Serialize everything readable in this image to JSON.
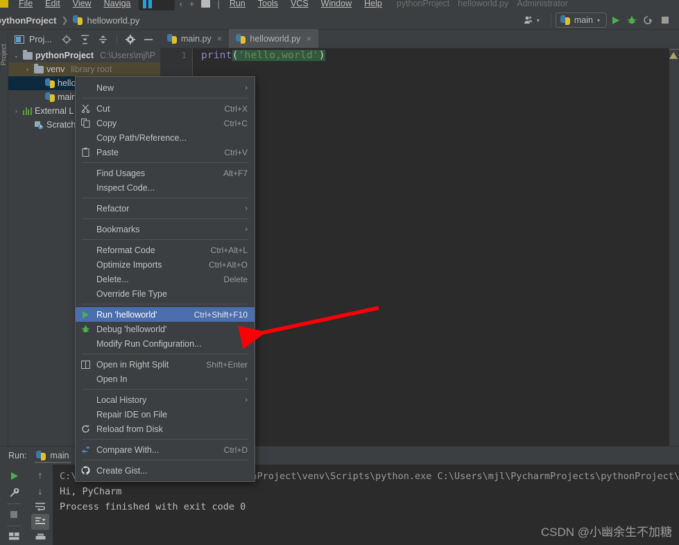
{
  "menubar": {
    "items": [
      "File",
      "Edit",
      "View",
      "Naviga"
    ],
    "items_right": [
      "Run",
      "Tools",
      "VCS",
      "Window",
      "Help"
    ],
    "window_title": "pythonProject - helloworld.py - Administrator",
    "title_project": "pythonProject",
    "title_file": "helloworld.py",
    "title_user": "Administrator"
  },
  "breadcrumb": {
    "project": "pythonProject",
    "separator": "❯",
    "file": "helloworld.py",
    "file_icon": "python-file-icon"
  },
  "topbar": {
    "user_icon": "user-settings-icon",
    "run_config": "main",
    "run_config_icon": "python-file-icon",
    "dropdown_caret": "▾",
    "run_icon": "run-icon",
    "debug_icon": "debug-icon",
    "coverage_icon": "run-with-coverage-icon",
    "stop_icon": "stop-icon"
  },
  "toolwindow": {
    "left_strip_label": "Project",
    "title": "Proj...",
    "title_icon": "project-window-icon",
    "icons": [
      "locate-icon",
      "expand-all-icon",
      "collapse-all-icon",
      "settings-gear-icon",
      "hide-icon"
    ]
  },
  "tree": {
    "items": [
      {
        "name": "pythonProject",
        "meta": "C:\\Users\\mjl\\P",
        "depth": 0,
        "arrow": "⌄",
        "icon": "folder-icon",
        "bold": true,
        "state": "none"
      },
      {
        "name": "venv",
        "meta": "library root",
        "depth": 1,
        "arrow": "›",
        "icon": "folder-icon",
        "bold": false,
        "state": "olive"
      },
      {
        "name": "hellow",
        "meta": "",
        "depth": 2,
        "arrow": "",
        "icon": "python-file-icon",
        "bold": false,
        "state": "blue"
      },
      {
        "name": "main.p",
        "meta": "",
        "depth": 2,
        "arrow": "",
        "icon": "python-file-icon",
        "bold": false,
        "state": "none"
      },
      {
        "name": "External L",
        "meta": "",
        "depth": 0,
        "arrow": "›",
        "icon": "library-icon",
        "bold": false,
        "state": "none"
      },
      {
        "name": "Scratches",
        "meta": "",
        "depth": 1,
        "arrow": "",
        "icon": "scratches-icon",
        "bold": false,
        "state": "none"
      }
    ]
  },
  "tabs": [
    {
      "label": "main.py",
      "icon": "python-file-icon",
      "active": false,
      "close": "×"
    },
    {
      "label": "helloworld.py",
      "icon": "python-file-icon",
      "active": true,
      "close": "×"
    }
  ],
  "editor": {
    "line_number": "1",
    "code_fn": "print",
    "code_open": "(",
    "code_string": "'hello,world'",
    "code_close": ")",
    "warning_icon": "warning-triangle-icon"
  },
  "contextmenu": {
    "groups": [
      [
        {
          "label": "New",
          "underline": "N",
          "key": "",
          "icon": "",
          "submenu": "›",
          "highlight": false
        }
      ],
      [
        {
          "label": "Cut",
          "underline": "C",
          "key": "Ctrl+X",
          "icon": "scissors-icon",
          "submenu": "",
          "highlight": false
        },
        {
          "label": "Copy",
          "underline": "C",
          "key": "Ctrl+C",
          "icon": "copy-icon",
          "submenu": "",
          "highlight": false
        },
        {
          "label": "Copy Path/Reference...",
          "underline": "",
          "key": "",
          "icon": "",
          "submenu": "",
          "highlight": false
        },
        {
          "label": "Paste",
          "underline": "P",
          "key": "Ctrl+V",
          "icon": "paste-icon",
          "submenu": "",
          "highlight": false
        }
      ],
      [
        {
          "label": "Find Usages",
          "underline": "U",
          "key": "Alt+F7",
          "icon": "",
          "submenu": "",
          "highlight": false
        },
        {
          "label": "Inspect Code...",
          "underline": "I",
          "key": "",
          "icon": "",
          "submenu": "",
          "highlight": false
        }
      ],
      [
        {
          "label": "Refactor",
          "underline": "R",
          "key": "",
          "icon": "",
          "submenu": "›",
          "highlight": false
        }
      ],
      [
        {
          "label": "Bookmarks",
          "underline": "",
          "key": "",
          "icon": "",
          "submenu": "›",
          "highlight": false
        }
      ],
      [
        {
          "label": "Reformat Code",
          "underline": "R",
          "key": "Ctrl+Alt+L",
          "icon": "",
          "submenu": "",
          "highlight": false
        },
        {
          "label": "Optimize Imports",
          "underline": "z",
          "key": "Ctrl+Alt+O",
          "icon": "",
          "submenu": "",
          "highlight": false
        },
        {
          "label": "Delete...",
          "underline": "D",
          "key": "Delete",
          "icon": "",
          "submenu": "",
          "highlight": false
        },
        {
          "label": "Override File Type",
          "underline": "",
          "key": "",
          "icon": "",
          "submenu": "",
          "highlight": false
        }
      ],
      [
        {
          "label": "Run 'helloworld'",
          "underline": "u",
          "key": "Ctrl+Shift+F10",
          "icon": "run-icon",
          "submenu": "",
          "highlight": true
        },
        {
          "label": "Debug 'helloworld'",
          "underline": "D",
          "key": "",
          "icon": "debug-icon",
          "submenu": "",
          "highlight": false
        },
        {
          "label": "Modify Run Configuration...",
          "underline": "",
          "key": "",
          "icon": "",
          "submenu": "",
          "highlight": false
        }
      ],
      [
        {
          "label": "Open in Right Split",
          "underline": "",
          "key": "Shift+Enter",
          "icon": "split-icon",
          "submenu": "",
          "highlight": false
        },
        {
          "label": "Open In",
          "underline": "",
          "key": "",
          "icon": "",
          "submenu": "›",
          "highlight": false
        }
      ],
      [
        {
          "label": "Local History",
          "underline": "H",
          "key": "",
          "icon": "",
          "submenu": "›",
          "highlight": false
        },
        {
          "label": "Repair IDE on File",
          "underline": "",
          "key": "",
          "icon": "",
          "submenu": "",
          "highlight": false
        },
        {
          "label": "Reload from Disk",
          "underline": "",
          "key": "",
          "icon": "reload-icon",
          "submenu": "",
          "highlight": false
        }
      ],
      [
        {
          "label": "Compare With...",
          "underline": "",
          "key": "Ctrl+D",
          "icon": "compare-icon",
          "submenu": "",
          "highlight": false
        }
      ],
      [
        {
          "label": "Create Gist...",
          "underline": "",
          "key": "",
          "icon": "github-icon",
          "submenu": "",
          "highlight": false
        }
      ]
    ]
  },
  "runpanel": {
    "label": "Run:",
    "tab_label": "main",
    "tab_icon": "python-file-icon",
    "side_icons": [
      "rerun-icon",
      "wrench-icon",
      "stop-icon",
      "layout-icon"
    ],
    "side_icons2": [
      "up-arrow-icon",
      "down-arrow-icon",
      "soft-wrap-icon",
      "scroll-to-end-icon",
      "print-icon"
    ],
    "console": [
      "C:\\Users\\mjl\\PycharmProjects\\pythonProject\\venv\\Scripts\\python.exe C:\\Users\\mjl\\PycharmProjects\\pythonProject\\mai",
      "Hi, PyCharm",
      "",
      "Process finished with exit code 0"
    ]
  },
  "watermark": "CSDN @小幽余生不加糖",
  "colors": {
    "accent_blue": "#4b6eaf",
    "annotation_red": "#fb0007",
    "selection_blue": "#0d293e",
    "selection_olive": "#4e4731",
    "editor_bg": "#2b2b2b",
    "panel_bg": "#3c3f41"
  }
}
